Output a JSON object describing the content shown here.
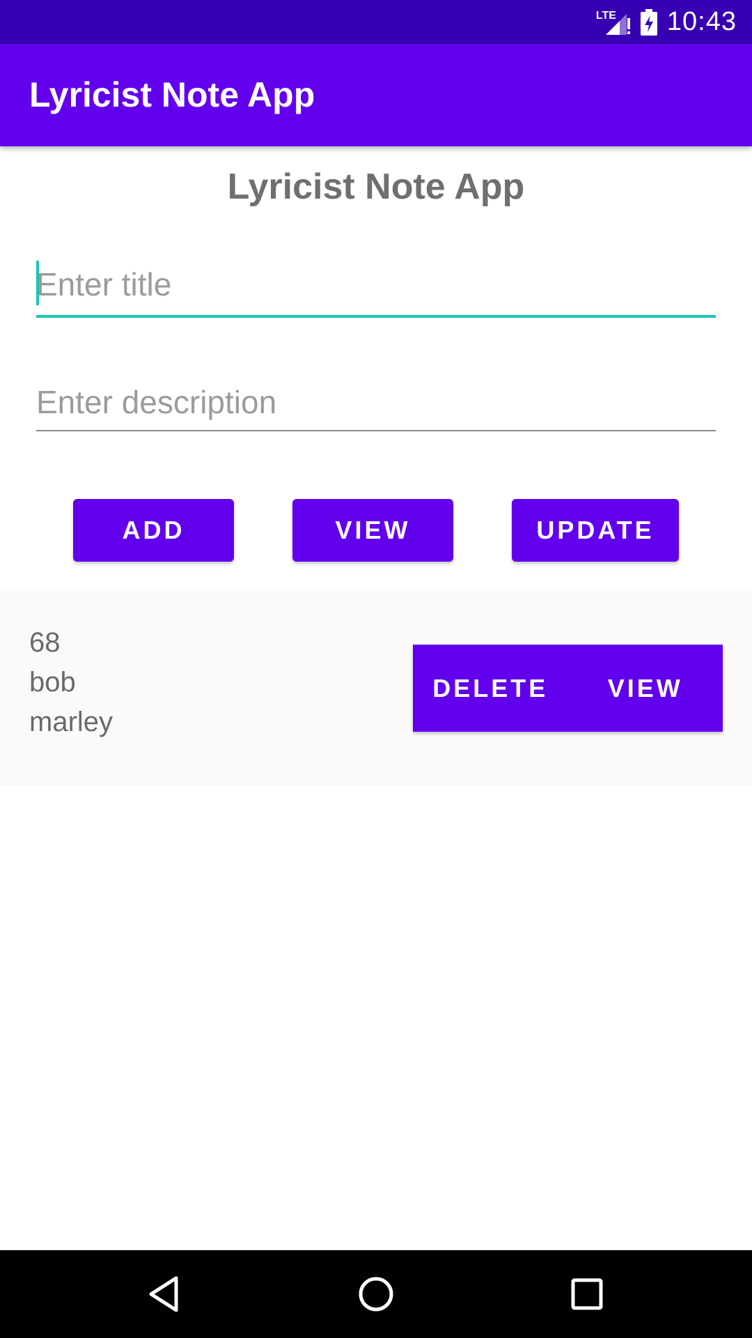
{
  "status_bar": {
    "network": "LTE",
    "time": "10:43",
    "icons": [
      "lte-signal-icon",
      "battery-charging-icon"
    ]
  },
  "app_bar": {
    "title": "Lyricist Note App"
  },
  "main": {
    "heading": "Lyricist Note App",
    "title_input": {
      "placeholder": "Enter title",
      "value": ""
    },
    "description_input": {
      "placeholder": "Enter description",
      "value": ""
    },
    "buttons": {
      "add": "ADD",
      "view": "VIEW",
      "update": "UPDATE"
    }
  },
  "notes": [
    {
      "id": "68",
      "title": "bob",
      "description": "marley",
      "delete_label": "DELETE",
      "view_label": "VIEW"
    }
  ],
  "colors": {
    "status_bar": "#3700b3",
    "primary": "#6200ee",
    "accent": "#1bc5b8"
  },
  "nav_bar": {
    "icons": [
      "back-icon",
      "home-icon",
      "recent-apps-icon"
    ]
  }
}
